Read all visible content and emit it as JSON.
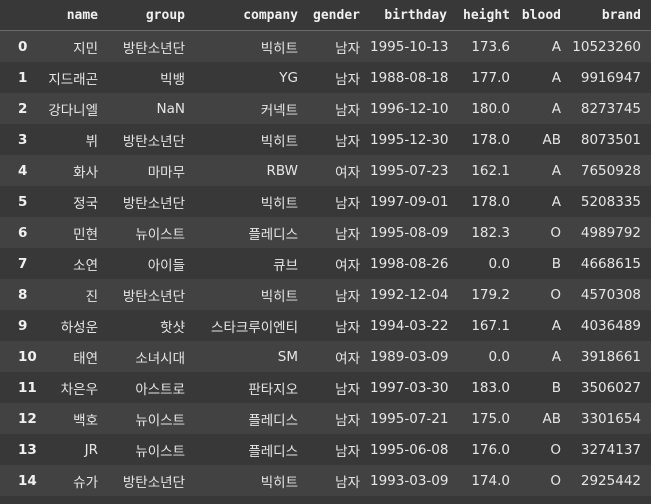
{
  "table": {
    "columns": [
      "name",
      "group",
      "company",
      "gender",
      "birthday",
      "height",
      "blood",
      "brand"
    ],
    "rows": [
      {
        "index": "0",
        "cells": [
          "지민",
          "방탄소년단",
          "빅히트",
          "남자",
          "1995-10-13",
          "173.6",
          "A",
          "10523260"
        ]
      },
      {
        "index": "1",
        "cells": [
          "지드래곤",
          "빅뱅",
          "YG",
          "남자",
          "1988-08-18",
          "177.0",
          "A",
          "9916947"
        ]
      },
      {
        "index": "2",
        "cells": [
          "강다니엘",
          "NaN",
          "커넥트",
          "남자",
          "1996-12-10",
          "180.0",
          "A",
          "8273745"
        ]
      },
      {
        "index": "3",
        "cells": [
          "뷔",
          "방탄소년단",
          "빅히트",
          "남자",
          "1995-12-30",
          "178.0",
          "AB",
          "8073501"
        ]
      },
      {
        "index": "4",
        "cells": [
          "화사",
          "마마무",
          "RBW",
          "여자",
          "1995-07-23",
          "162.1",
          "A",
          "7650928"
        ]
      },
      {
        "index": "5",
        "cells": [
          "정국",
          "방탄소년단",
          "빅히트",
          "남자",
          "1997-09-01",
          "178.0",
          "A",
          "5208335"
        ]
      },
      {
        "index": "6",
        "cells": [
          "민현",
          "뉴이스트",
          "플레디스",
          "남자",
          "1995-08-09",
          "182.3",
          "O",
          "4989792"
        ]
      },
      {
        "index": "7",
        "cells": [
          "소연",
          "아이들",
          "큐브",
          "여자",
          "1998-08-26",
          "0.0",
          "B",
          "4668615"
        ]
      },
      {
        "index": "8",
        "cells": [
          "진",
          "방탄소년단",
          "빅히트",
          "남자",
          "1992-12-04",
          "179.2",
          "O",
          "4570308"
        ]
      },
      {
        "index": "9",
        "cells": [
          "하성운",
          "핫샷",
          "스타크루이엔티",
          "남자",
          "1994-03-22",
          "167.1",
          "A",
          "4036489"
        ]
      },
      {
        "index": "10",
        "cells": [
          "태연",
          "소녀시대",
          "SM",
          "여자",
          "1989-03-09",
          "0.0",
          "A",
          "3918661"
        ]
      },
      {
        "index": "11",
        "cells": [
          "차은우",
          "아스트로",
          "판타지오",
          "남자",
          "1997-03-30",
          "183.0",
          "B",
          "3506027"
        ]
      },
      {
        "index": "12",
        "cells": [
          "백호",
          "뉴이스트",
          "플레디스",
          "남자",
          "1995-07-21",
          "175.0",
          "AB",
          "3301654"
        ]
      },
      {
        "index": "13",
        "cells": [
          "JR",
          "뉴이스트",
          "플레디스",
          "남자",
          "1995-06-08",
          "176.0",
          "O",
          "3274137"
        ]
      },
      {
        "index": "14",
        "cells": [
          "슈가",
          "방탄소년단",
          "빅히트",
          "남자",
          "1993-03-09",
          "174.0",
          "O",
          "2925442"
        ]
      }
    ]
  },
  "colors": {
    "background": "#383838",
    "row_stripe": "#424242",
    "text": "#e6e6e6"
  }
}
